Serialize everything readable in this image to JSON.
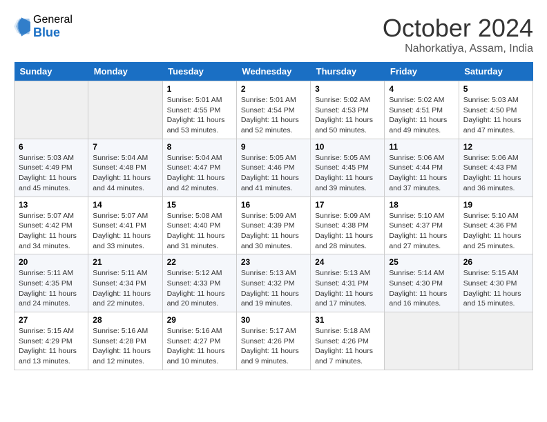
{
  "logo": {
    "general": "General",
    "blue": "Blue"
  },
  "title": "October 2024",
  "location": "Nahorkatiya, Assam, India",
  "days_of_week": [
    "Sunday",
    "Monday",
    "Tuesday",
    "Wednesday",
    "Thursday",
    "Friday",
    "Saturday"
  ],
  "weeks": [
    [
      {
        "day": "",
        "info": ""
      },
      {
        "day": "",
        "info": ""
      },
      {
        "day": "1",
        "info": "Sunrise: 5:01 AM\nSunset: 4:55 PM\nDaylight: 11 hours and 53 minutes."
      },
      {
        "day": "2",
        "info": "Sunrise: 5:01 AM\nSunset: 4:54 PM\nDaylight: 11 hours and 52 minutes."
      },
      {
        "day": "3",
        "info": "Sunrise: 5:02 AM\nSunset: 4:53 PM\nDaylight: 11 hours and 50 minutes."
      },
      {
        "day": "4",
        "info": "Sunrise: 5:02 AM\nSunset: 4:51 PM\nDaylight: 11 hours and 49 minutes."
      },
      {
        "day": "5",
        "info": "Sunrise: 5:03 AM\nSunset: 4:50 PM\nDaylight: 11 hours and 47 minutes."
      }
    ],
    [
      {
        "day": "6",
        "info": "Sunrise: 5:03 AM\nSunset: 4:49 PM\nDaylight: 11 hours and 45 minutes."
      },
      {
        "day": "7",
        "info": "Sunrise: 5:04 AM\nSunset: 4:48 PM\nDaylight: 11 hours and 44 minutes."
      },
      {
        "day": "8",
        "info": "Sunrise: 5:04 AM\nSunset: 4:47 PM\nDaylight: 11 hours and 42 minutes."
      },
      {
        "day": "9",
        "info": "Sunrise: 5:05 AM\nSunset: 4:46 PM\nDaylight: 11 hours and 41 minutes."
      },
      {
        "day": "10",
        "info": "Sunrise: 5:05 AM\nSunset: 4:45 PM\nDaylight: 11 hours and 39 minutes."
      },
      {
        "day": "11",
        "info": "Sunrise: 5:06 AM\nSunset: 4:44 PM\nDaylight: 11 hours and 37 minutes."
      },
      {
        "day": "12",
        "info": "Sunrise: 5:06 AM\nSunset: 4:43 PM\nDaylight: 11 hours and 36 minutes."
      }
    ],
    [
      {
        "day": "13",
        "info": "Sunrise: 5:07 AM\nSunset: 4:42 PM\nDaylight: 11 hours and 34 minutes."
      },
      {
        "day": "14",
        "info": "Sunrise: 5:07 AM\nSunset: 4:41 PM\nDaylight: 11 hours and 33 minutes."
      },
      {
        "day": "15",
        "info": "Sunrise: 5:08 AM\nSunset: 4:40 PM\nDaylight: 11 hours and 31 minutes."
      },
      {
        "day": "16",
        "info": "Sunrise: 5:09 AM\nSunset: 4:39 PM\nDaylight: 11 hours and 30 minutes."
      },
      {
        "day": "17",
        "info": "Sunrise: 5:09 AM\nSunset: 4:38 PM\nDaylight: 11 hours and 28 minutes."
      },
      {
        "day": "18",
        "info": "Sunrise: 5:10 AM\nSunset: 4:37 PM\nDaylight: 11 hours and 27 minutes."
      },
      {
        "day": "19",
        "info": "Sunrise: 5:10 AM\nSunset: 4:36 PM\nDaylight: 11 hours and 25 minutes."
      }
    ],
    [
      {
        "day": "20",
        "info": "Sunrise: 5:11 AM\nSunset: 4:35 PM\nDaylight: 11 hours and 24 minutes."
      },
      {
        "day": "21",
        "info": "Sunrise: 5:11 AM\nSunset: 4:34 PM\nDaylight: 11 hours and 22 minutes."
      },
      {
        "day": "22",
        "info": "Sunrise: 5:12 AM\nSunset: 4:33 PM\nDaylight: 11 hours and 20 minutes."
      },
      {
        "day": "23",
        "info": "Sunrise: 5:13 AM\nSunset: 4:32 PM\nDaylight: 11 hours and 19 minutes."
      },
      {
        "day": "24",
        "info": "Sunrise: 5:13 AM\nSunset: 4:31 PM\nDaylight: 11 hours and 17 minutes."
      },
      {
        "day": "25",
        "info": "Sunrise: 5:14 AM\nSunset: 4:30 PM\nDaylight: 11 hours and 16 minutes."
      },
      {
        "day": "26",
        "info": "Sunrise: 5:15 AM\nSunset: 4:30 PM\nDaylight: 11 hours and 15 minutes."
      }
    ],
    [
      {
        "day": "27",
        "info": "Sunrise: 5:15 AM\nSunset: 4:29 PM\nDaylight: 11 hours and 13 minutes."
      },
      {
        "day": "28",
        "info": "Sunrise: 5:16 AM\nSunset: 4:28 PM\nDaylight: 11 hours and 12 minutes."
      },
      {
        "day": "29",
        "info": "Sunrise: 5:16 AM\nSunset: 4:27 PM\nDaylight: 11 hours and 10 minutes."
      },
      {
        "day": "30",
        "info": "Sunrise: 5:17 AM\nSunset: 4:26 PM\nDaylight: 11 hours and 9 minutes."
      },
      {
        "day": "31",
        "info": "Sunrise: 5:18 AM\nSunset: 4:26 PM\nDaylight: 11 hours and 7 minutes."
      },
      {
        "day": "",
        "info": ""
      },
      {
        "day": "",
        "info": ""
      }
    ]
  ]
}
